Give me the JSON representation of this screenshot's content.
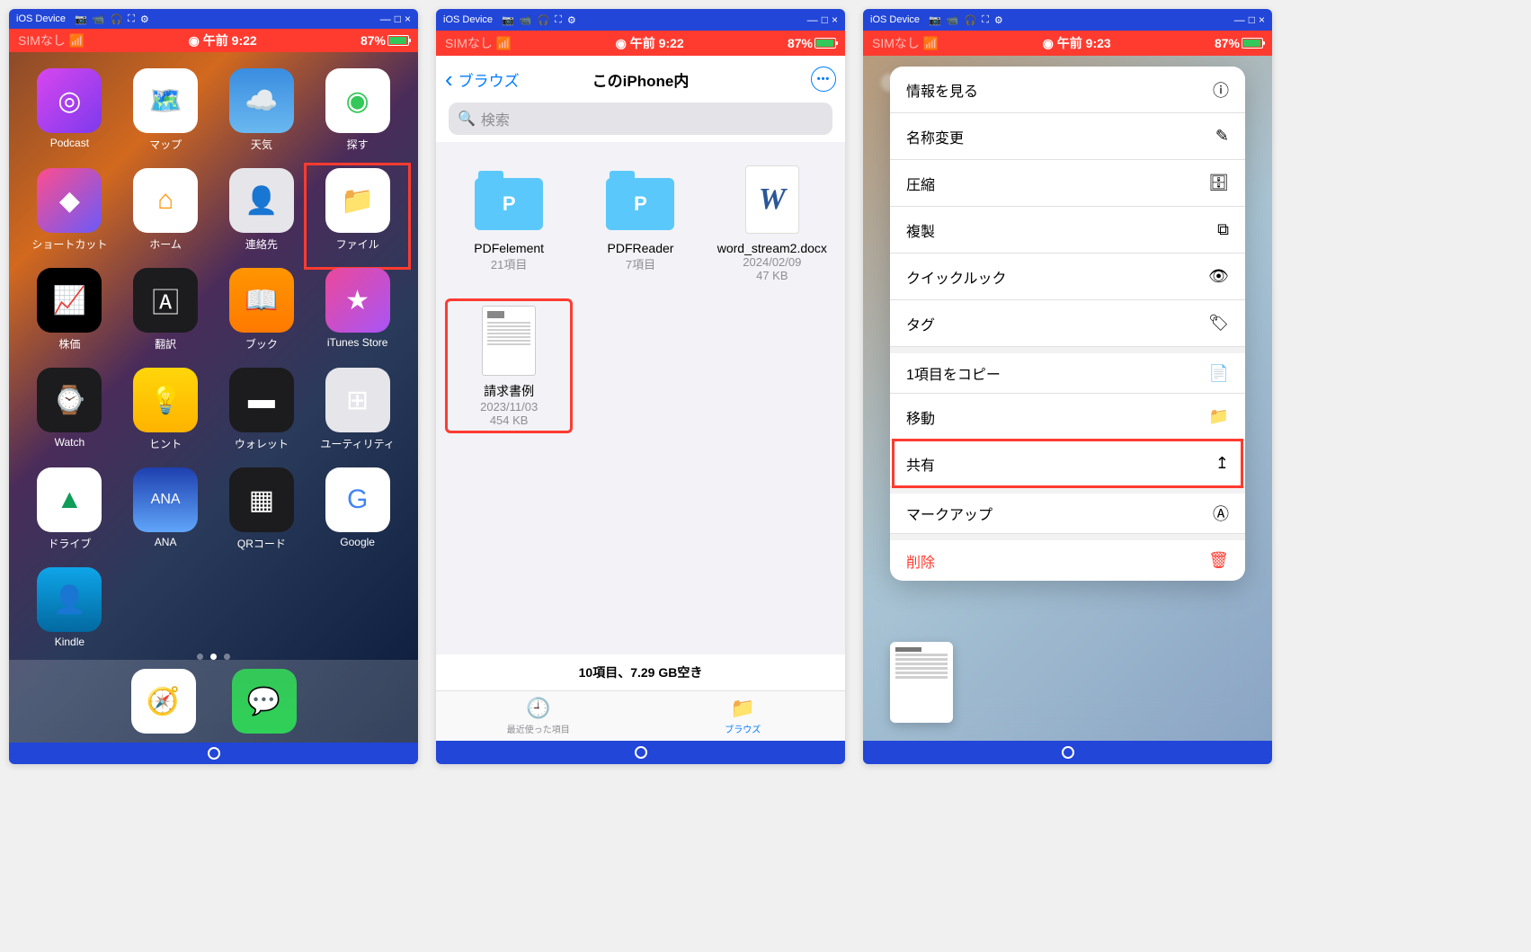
{
  "titlebar": {
    "device": "iOS Device",
    "icons": [
      "📷",
      "📹",
      "🎧",
      "⛶",
      "⚙"
    ],
    "wincontrols": [
      "—",
      "□",
      "×"
    ]
  },
  "statusbar": {
    "sim": "SIMなし",
    "rec": "◉",
    "time1": "午前 9:22",
    "time3": "午前 9:23",
    "battery": "87%"
  },
  "phone1": {
    "apps": [
      {
        "label": "Podcast",
        "bg": "linear-gradient(135deg,#d946ef,#7c3aed)",
        "glyph": "◎"
      },
      {
        "label": "マップ",
        "bg": "#fff",
        "glyph": "🗺️"
      },
      {
        "label": "天気",
        "bg": "linear-gradient(#3a8de0,#6ab8f0)",
        "glyph": "☁️"
      },
      {
        "label": "探す",
        "bg": "#fff",
        "glyph": "◉",
        "color": "#34c759"
      },
      {
        "label": "ショートカット",
        "bg": "linear-gradient(135deg,#ff4d8d,#6a5af9)",
        "glyph": "◆"
      },
      {
        "label": "ホーム",
        "bg": "#fff",
        "glyph": "⌂",
        "color": "#ff9500"
      },
      {
        "label": "連絡先",
        "bg": "#e5e5ea",
        "glyph": "👤",
        "color": "#777"
      },
      {
        "label": "ファイル",
        "bg": "#fff",
        "glyph": "📁",
        "color": "#0a84ff",
        "hl": true
      },
      {
        "label": "株価",
        "bg": "#000",
        "glyph": "📈"
      },
      {
        "label": "翻訳",
        "bg": "#1c1c1e",
        "glyph": "🄰"
      },
      {
        "label": "ブック",
        "bg": "linear-gradient(#ff9500,#ff7a00)",
        "glyph": "📖"
      },
      {
        "label": "iTunes Store",
        "bg": "linear-gradient(135deg,#ec4899,#a855f7)",
        "glyph": "★"
      },
      {
        "label": "Watch",
        "bg": "#1c1c1e",
        "glyph": "⌚"
      },
      {
        "label": "ヒント",
        "bg": "linear-gradient(#ffd60a,#ffb300)",
        "glyph": "💡"
      },
      {
        "label": "ウォレット",
        "bg": "#1c1c1e",
        "glyph": "▬"
      },
      {
        "label": "ユーティリティ",
        "bg": "#e5e5ea",
        "glyph": "⊞"
      },
      {
        "label": "ドライブ",
        "bg": "#fff",
        "glyph": "▲",
        "color": "#0f9d58"
      },
      {
        "label": "ANA",
        "bg": "linear-gradient(#1e40af,#60a5fa)",
        "glyph": "ANA",
        "fs": "16px"
      },
      {
        "label": "QRコード",
        "bg": "#1c1c1e",
        "glyph": "▦"
      },
      {
        "label": "Google",
        "bg": "#fff",
        "glyph": "G",
        "color": "#4285f4"
      },
      {
        "label": "Kindle",
        "bg": "linear-gradient(#0ea5e9,#0369a1)",
        "glyph": "👤"
      }
    ],
    "dock": [
      {
        "bg": "#fff",
        "glyph": "🧭",
        "name": "safari"
      },
      {
        "bg": "linear-gradient(#34c759,#30d158)",
        "glyph": "💬",
        "name": "messages"
      }
    ]
  },
  "phone2": {
    "back": "ブラウズ",
    "title": "このiPhone内",
    "search_placeholder": "検索",
    "items": [
      {
        "kind": "folder",
        "name": "PDFelement",
        "meta": "21項目",
        "glyph": "P"
      },
      {
        "kind": "folder",
        "name": "PDFReader",
        "meta": "7項目",
        "glyph": "P"
      },
      {
        "kind": "doc",
        "name": "word_stream2.docx",
        "meta1": "2024/02/09",
        "meta2": "47 KB"
      },
      {
        "kind": "pdf",
        "name": "請求書例",
        "meta1": "2023/11/03",
        "meta2": "454 KB",
        "hl": true
      }
    ],
    "summary": "10項目、7.29 GB空き",
    "tabs": {
      "recent": "最近使った項目",
      "browse": "ブラウズ"
    }
  },
  "phone3": {
    "menu": [
      {
        "label": "情報を見る",
        "icon": "ⓘ"
      },
      {
        "label": "名称変更",
        "icon": "✎"
      },
      {
        "label": "圧縮",
        "icon": "🗄"
      },
      {
        "label": "複製",
        "icon": "⧉"
      },
      {
        "label": "クイックルック",
        "icon": "👁"
      },
      {
        "label": "タグ",
        "icon": "🏷"
      },
      {
        "label": "1項目をコピー",
        "icon": "📄",
        "sep": true
      },
      {
        "label": "移動",
        "icon": "📁"
      },
      {
        "label": "共有",
        "icon": "↥",
        "hl": true
      },
      {
        "label": "マークアップ",
        "icon": "Ⓐ",
        "sep": true
      },
      {
        "label": "削除",
        "icon": "🗑",
        "danger": true,
        "sep": true
      }
    ]
  }
}
